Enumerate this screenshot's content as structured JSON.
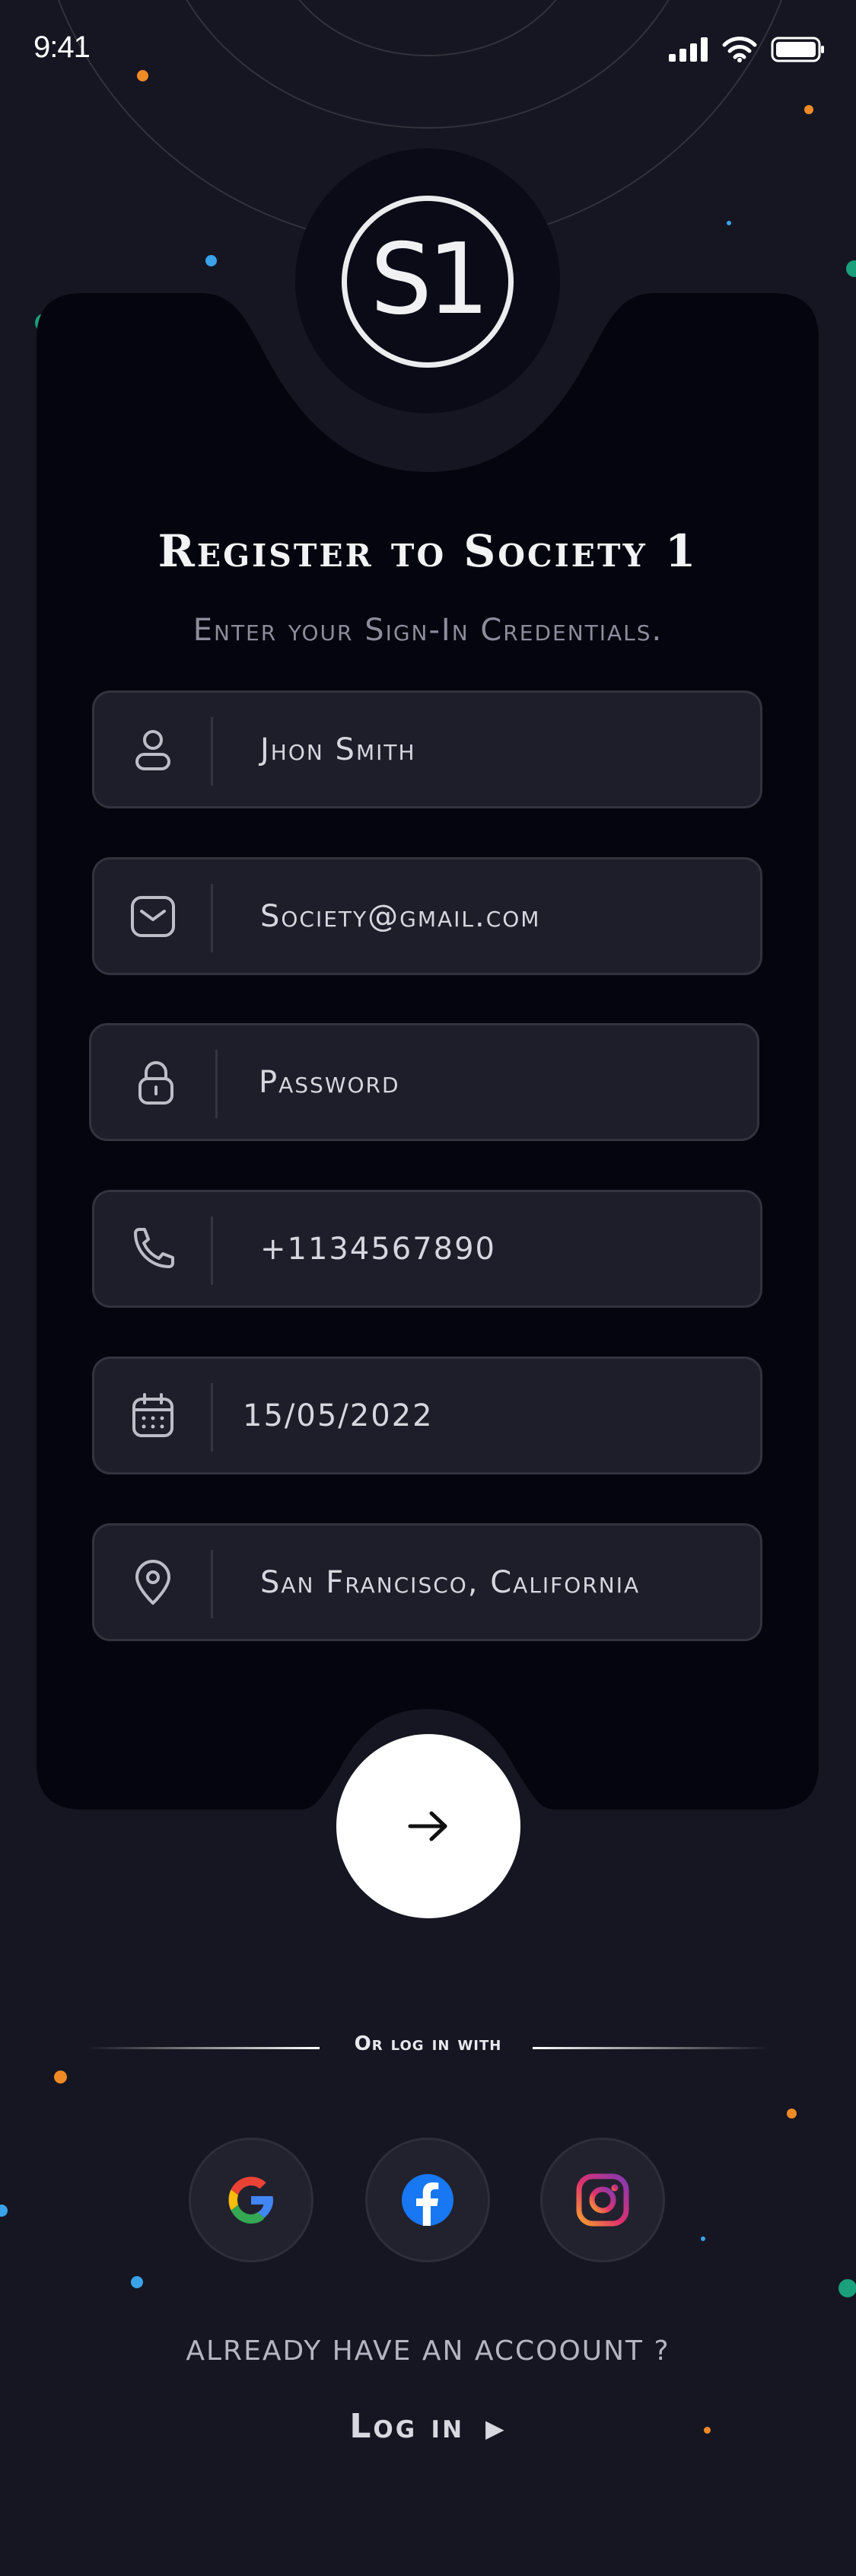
{
  "status_bar": {
    "time": "9:41"
  },
  "logo": {
    "text": "S1"
  },
  "header": {
    "title": "Register to Society 1",
    "subtitle": "Enter your Sign-In Credentials."
  },
  "fields": [
    {
      "name": "name",
      "icon": "user-icon",
      "value": "Jhon Smith"
    },
    {
      "name": "email",
      "icon": "mail-icon",
      "value": "Society@gmail.com"
    },
    {
      "name": "password",
      "icon": "lock-icon",
      "value": "Password"
    },
    {
      "name": "phone",
      "icon": "phone-icon",
      "value": "+1134567890"
    },
    {
      "name": "date",
      "icon": "calendar-icon",
      "value": "15/05/2022"
    },
    {
      "name": "location",
      "icon": "location-pin-icon",
      "value": "San Francisco, California"
    }
  ],
  "submit": {
    "icon": "arrow-right-icon"
  },
  "divider": {
    "text": "Or log in with"
  },
  "social": [
    {
      "name": "google",
      "icon": "google-icon"
    },
    {
      "name": "facebook",
      "icon": "facebook-icon"
    },
    {
      "name": "instagram",
      "icon": "instagram-icon"
    }
  ],
  "footer": {
    "prompt": "ALREADY HAVE AN ACCOOUNT ?",
    "login_label": "Log in"
  },
  "colors": {
    "background": "#161622",
    "card": "#05050f",
    "field": "#1e1e2a",
    "accent_orange": "#f08a24",
    "accent_blue": "#3aa2e8",
    "accent_green": "#1aa07a"
  }
}
